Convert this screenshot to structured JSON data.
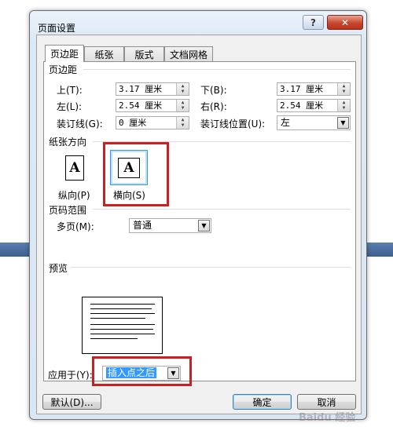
{
  "window": {
    "title": "页面设置",
    "help_label": "?",
    "close_label": "✕"
  },
  "tabs": [
    {
      "label": "页边距",
      "active": true
    },
    {
      "label": "纸张",
      "active": false
    },
    {
      "label": "版式",
      "active": false
    },
    {
      "label": "文档网格",
      "active": false
    }
  ],
  "margins": {
    "section_label": "页边距",
    "top_label": "上(T):",
    "top_value": "3.17 厘米",
    "bottom_label": "下(B):",
    "bottom_value": "3.17 厘米",
    "left_label": "左(L):",
    "left_value": "2.54 厘米",
    "right_label": "右(R):",
    "right_value": "2.54 厘米",
    "gutter_label": "装订线(G):",
    "gutter_value": "0 厘米",
    "gutter_pos_label": "装订线位置(U):",
    "gutter_pos_value": "左"
  },
  "orientation": {
    "section_label": "纸张方向",
    "portrait_label": "纵向(P)",
    "landscape_label": "横向(S)",
    "selected": "landscape"
  },
  "pages": {
    "section_label": "页码范围",
    "multiple_label": "多页(M):",
    "multiple_value": "普通"
  },
  "preview": {
    "section_label": "预览"
  },
  "apply": {
    "label": "应用于(Y):",
    "value": "插入点之后"
  },
  "buttons": {
    "default_label": "默认(D)...",
    "ok_label": "确定",
    "cancel_label": "取消"
  },
  "watermark": "Baidu 经验",
  "colors": {
    "highlight_red": "#cc1f1f",
    "selection_blue": "#3399ff"
  }
}
